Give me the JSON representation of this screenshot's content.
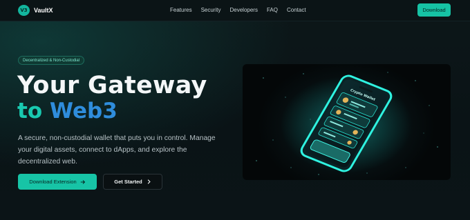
{
  "nav": {
    "logo_badge": "V3",
    "brand": "VaultX",
    "links": [
      "Features",
      "Security",
      "Developers",
      "FAQ",
      "Contact"
    ],
    "download_label": "Download"
  },
  "hero": {
    "badge": "Decentralized & Non-Custodial",
    "headline_line1": "Your Gateway",
    "headline_to": "to",
    "headline_web3": "Web3",
    "description": "A secure, non-custodial wallet that puts you in control. Manage your digital assets, connect to dApps, and explore the decentralized web.",
    "primary_cta": "Download Extension",
    "secondary_cta": "Get Started",
    "phone_title": "Crypto Wallet"
  },
  "colors": {
    "accent": "#16c2a4",
    "blue": "#2f8ddc",
    "background": "#0a1114"
  },
  "icons": {
    "primary_cta_icon": "arrow-right-icon",
    "secondary_cta_icon": "chevron-right-icon"
  }
}
